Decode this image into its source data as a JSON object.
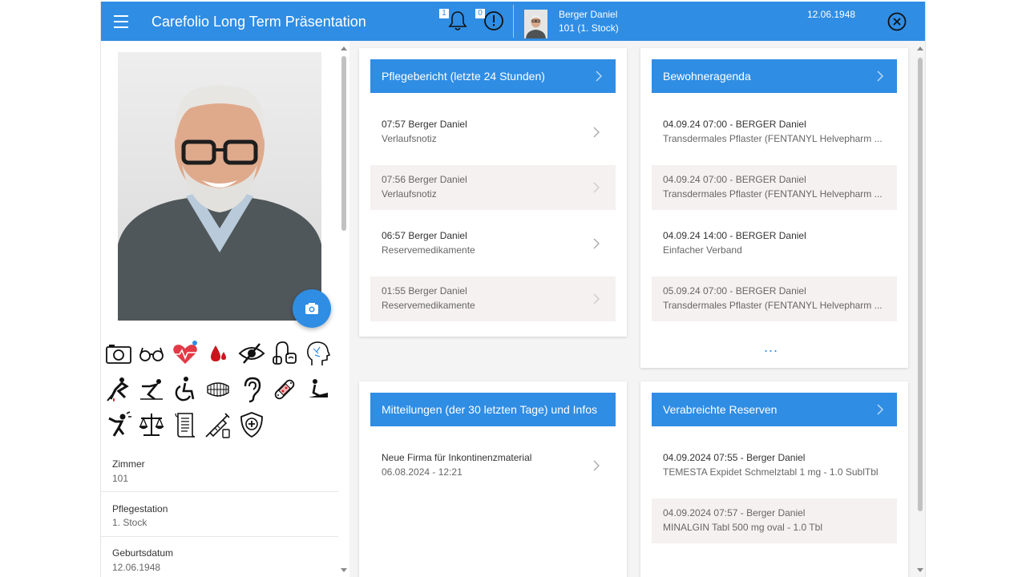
{
  "header": {
    "app_title": "Carefolio Long Term Präsentation",
    "notifications_count": "1",
    "alerts_count": "0",
    "patient_name": "Berger Daniel",
    "patient_room": "101 (1. Stock)",
    "patient_dob": "12.06.1948"
  },
  "left": {
    "risk_icons": [
      "camera-icon",
      "glasses-icon",
      "heart-monitor-icon",
      "blood-drop-icon",
      "eye-crossed-icon",
      "hearing-aid-icon",
      "head-profile-icon",
      "fall-icon",
      "slip-icon",
      "wheelchair-icon",
      "dentures-icon",
      "ear-icon",
      "bandage-icon",
      "ramp-icon",
      "fall-injury-icon",
      "scale-icon",
      "document-scroll-icon",
      "syringe-icon",
      "shield-medical-icon"
    ],
    "info": [
      {
        "label": "Zimmer",
        "value": "101"
      },
      {
        "label": "Pflegestation",
        "value": "1. Stock"
      },
      {
        "label": "Geburtsdatum",
        "value": "12.06.1948"
      }
    ]
  },
  "cards": {
    "pflegebericht": {
      "title": "Pflegebericht (letzte 24 Stunden)",
      "items": [
        {
          "l1": "07:57 Berger Daniel",
          "l2": "Verlaufsnotiz"
        },
        {
          "l1": "07:56 Berger Daniel",
          "l2": "Verlaufsnotiz"
        },
        {
          "l1": "06:57 Berger Daniel",
          "l2": "Reservemedikamente"
        },
        {
          "l1": "01:55 Berger Daniel",
          "l2": "Reservemedikamente"
        }
      ]
    },
    "agenda": {
      "title": "Bewohneragenda",
      "items": [
        {
          "l1": "04.09.24 07:00 - BERGER Daniel",
          "l2": "Transdermales Pflaster (FENTANYL Helvepharm ..."
        },
        {
          "l1": "04.09.24 07:00 - BERGER Daniel",
          "l2": "Transdermales Pflaster (FENTANYL Helvepharm ..."
        },
        {
          "l1": "04.09.24 14:00 - BERGER Daniel",
          "l2": "Einfacher Verband"
        },
        {
          "l1": "05.09.24 07:00 - BERGER Daniel",
          "l2": "Transdermales Pflaster (FENTANYL Helvepharm ..."
        }
      ],
      "more": "..."
    },
    "mitteilungen": {
      "title": "Mitteilungen (der 30 letzten Tage) und Infos",
      "items": [
        {
          "l1": "Neue Firma für Inkontinenzmaterial",
          "l2": "06.08.2024 - 12:21"
        }
      ]
    },
    "reserven": {
      "title": "Verabreichte Reserven",
      "items": [
        {
          "l1": "04.09.2024 07:55 - Berger Daniel",
          "l2": "TEMESTA Expidet Schmelztabl 1 mg - 1.0 SublTbl"
        },
        {
          "l1": "04.09.2024 07:57 - Berger Daniel",
          "l2": "MINALGIN Tabl 500 mg oval - 1.0 Tbl"
        }
      ]
    }
  },
  "colors": {
    "accent": "#2f8de4",
    "shaded_row": "#f5f1f0"
  }
}
